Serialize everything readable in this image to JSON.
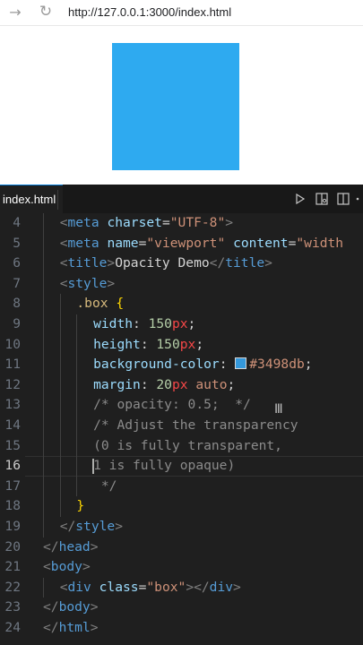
{
  "browser": {
    "url": "http://127.0.0.1:3000/index.html",
    "forward_icon": "arrow-right-icon",
    "reload_icon": "reload-icon"
  },
  "preview": {
    "box_color": "#2eaaf0"
  },
  "editor": {
    "tab_label": "index.html",
    "actions": [
      "run-icon",
      "open-preview-icon",
      "split-editor-icon"
    ],
    "active_line": "16",
    "lines": [
      {
        "no": "4",
        "indent": 1,
        "tokens": [
          [
            "t-bracket",
            "<"
          ],
          [
            "t-tag",
            "meta"
          ],
          [
            "t-text",
            " "
          ],
          [
            "t-attr",
            "charset"
          ],
          [
            "t-text",
            "="
          ],
          [
            "t-str",
            "\"UTF-8\""
          ],
          [
            "t-bracket",
            ">"
          ]
        ]
      },
      {
        "no": "5",
        "indent": 1,
        "tokens": [
          [
            "t-bracket",
            "<"
          ],
          [
            "t-tag",
            "meta"
          ],
          [
            "t-text",
            " "
          ],
          [
            "t-attr",
            "name"
          ],
          [
            "t-text",
            "="
          ],
          [
            "t-str",
            "\"viewport\""
          ],
          [
            "t-text",
            " "
          ],
          [
            "t-attr",
            "content"
          ],
          [
            "t-text",
            "="
          ],
          [
            "t-str",
            "\"width"
          ]
        ]
      },
      {
        "no": "6",
        "indent": 1,
        "tokens": [
          [
            "t-bracket",
            "<"
          ],
          [
            "t-tag",
            "title"
          ],
          [
            "t-bracket",
            ">"
          ],
          [
            "t-text",
            "Opacity Demo"
          ],
          [
            "t-bracket",
            "</"
          ],
          [
            "t-tag",
            "title"
          ],
          [
            "t-bracket",
            ">"
          ]
        ]
      },
      {
        "no": "7",
        "indent": 1,
        "tokens": [
          [
            "t-bracket",
            "<"
          ],
          [
            "t-tag",
            "style"
          ],
          [
            "t-bracket",
            ">"
          ]
        ]
      },
      {
        "no": "8",
        "indent": 2,
        "tokens": [
          [
            "t-sel",
            ".box"
          ],
          [
            "t-text",
            " "
          ],
          [
            "t-brace",
            "{"
          ]
        ]
      },
      {
        "no": "9",
        "indent": 3,
        "tokens": [
          [
            "t-prop",
            "width"
          ],
          [
            "t-text",
            ": "
          ],
          [
            "t-num",
            "150"
          ],
          [
            "t-unit",
            "px"
          ],
          [
            "t-text",
            ";"
          ]
        ]
      },
      {
        "no": "10",
        "indent": 3,
        "tokens": [
          [
            "t-prop",
            "height"
          ],
          [
            "t-text",
            ": "
          ],
          [
            "t-num",
            "150"
          ],
          [
            "t-unit",
            "px"
          ],
          [
            "t-text",
            ";"
          ]
        ]
      },
      {
        "no": "11",
        "indent": 3,
        "tokens": [
          [
            "t-prop",
            "background-color"
          ],
          [
            "t-text",
            ": "
          ],
          [
            "swatch",
            "#3498db"
          ],
          [
            "t-val",
            "#3498db"
          ],
          [
            "t-text",
            ";"
          ]
        ]
      },
      {
        "no": "12",
        "indent": 3,
        "tokens": [
          [
            "t-prop",
            "margin"
          ],
          [
            "t-text",
            ": "
          ],
          [
            "t-num",
            "20"
          ],
          [
            "t-unit",
            "px"
          ],
          [
            "t-text",
            " "
          ],
          [
            "t-val",
            "auto"
          ],
          [
            "t-text",
            ";"
          ]
        ]
      },
      {
        "no": "13",
        "indent": 3,
        "tokens": [
          [
            "t-com-dim",
            "/* opacity: 0.5;  */"
          ]
        ]
      },
      {
        "no": "14",
        "indent": 3,
        "tokens": [
          [
            "t-com-dim",
            "/* Adjust the transparency"
          ]
        ]
      },
      {
        "no": "15",
        "indent": 3,
        "tokens": [
          [
            "t-com-dim",
            "(0 is fully transparent,"
          ]
        ]
      },
      {
        "no": "16",
        "indent": 3,
        "tokens": [
          [
            "t-com-dim",
            "1 is fully opaque)"
          ]
        ]
      },
      {
        "no": "17",
        "indent": 3,
        "tokens": [
          [
            "t-com-dim",
            " */"
          ]
        ]
      },
      {
        "no": "18",
        "indent": 2,
        "tokens": [
          [
            "t-brace",
            "}"
          ]
        ]
      },
      {
        "no": "19",
        "indent": 1,
        "tokens": [
          [
            "t-bracket",
            "</"
          ],
          [
            "t-tag",
            "style"
          ],
          [
            "t-bracket",
            ">"
          ]
        ]
      },
      {
        "no": "20",
        "indent": 0,
        "tokens": [
          [
            "t-bracket",
            "</"
          ],
          [
            "t-tag",
            "head"
          ],
          [
            "t-bracket",
            ">"
          ]
        ]
      },
      {
        "no": "21",
        "indent": 0,
        "tokens": [
          [
            "t-bracket",
            "<"
          ],
          [
            "t-tag",
            "body"
          ],
          [
            "t-bracket",
            ">"
          ]
        ]
      },
      {
        "no": "22",
        "indent": 1,
        "tokens": [
          [
            "t-bracket",
            "<"
          ],
          [
            "t-tag",
            "div"
          ],
          [
            "t-text",
            " "
          ],
          [
            "t-attr",
            "class"
          ],
          [
            "t-text",
            "="
          ],
          [
            "t-str",
            "\"box\""
          ],
          [
            "t-bracket",
            "></"
          ],
          [
            "t-tag",
            "div"
          ],
          [
            "t-bracket",
            ">"
          ]
        ]
      },
      {
        "no": "23",
        "indent": 0,
        "tokens": [
          [
            "t-bracket",
            "</"
          ],
          [
            "t-tag",
            "body"
          ],
          [
            "t-bracket",
            ">"
          ]
        ]
      },
      {
        "no": "24",
        "indent": 0,
        "tokens": [
          [
            "t-bracket",
            "</"
          ],
          [
            "t-tag",
            "html"
          ],
          [
            "t-bracket",
            ">"
          ]
        ]
      }
    ]
  }
}
